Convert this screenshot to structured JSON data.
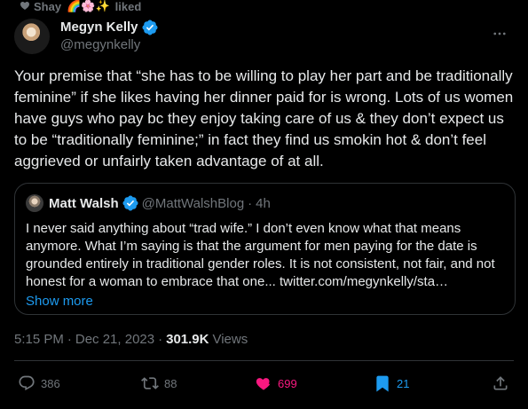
{
  "social_context": {
    "user": "Shay",
    "emoji": "🌈🌸✨",
    "action": "liked"
  },
  "author": {
    "name": "Megyn Kelly",
    "handle": "@megynkelly"
  },
  "tweet": {
    "text": "Your premise that “she has to be willing to play her part and be traditionally feminine” if she likes having her dinner paid for is wrong. Lots of us women have guys who pay bc they enjoy taking care of us & they don’t expect us to be “traditionally feminine;” in fact they find us smokin hot & don’t feel aggrieved or unfairly taken advantage of at all."
  },
  "quote": {
    "name": "Matt Walsh",
    "handle": "@MattWalshBlog",
    "separator": "·",
    "time": "4h",
    "text": "I never said anything about “trad wife.” I don’t even know what that means anymore. What I’m saying is that the argument for men paying for the date is grounded entirely in traditional gender roles. It is not consistent, not fair, and not honest for a woman to embrace that one... twitter.com/megynkelly/sta…",
    "show_more": "Show more"
  },
  "meta": {
    "time": "5:15 PM",
    "sep1": "·",
    "date": "Dec 21, 2023",
    "sep2": "·",
    "views_count": "301.9K",
    "views_label": "Views"
  },
  "actions": {
    "replies": "386",
    "retweets": "88",
    "likes": "699",
    "bookmarks": "21"
  },
  "colors": {
    "background": "#000000",
    "text": "#e7e9ea",
    "secondary": "#71767b",
    "accent": "#1d9bf0",
    "like": "#f91880",
    "border": "#2f3336"
  },
  "icons": {
    "social_context": "heart-icon",
    "more": "more-icon",
    "reply": "reply-icon",
    "retweet": "retweet-icon",
    "like": "like-filled-icon",
    "bookmark": "bookmark-filled-icon",
    "share": "share-icon",
    "verified": "verified-icon"
  }
}
